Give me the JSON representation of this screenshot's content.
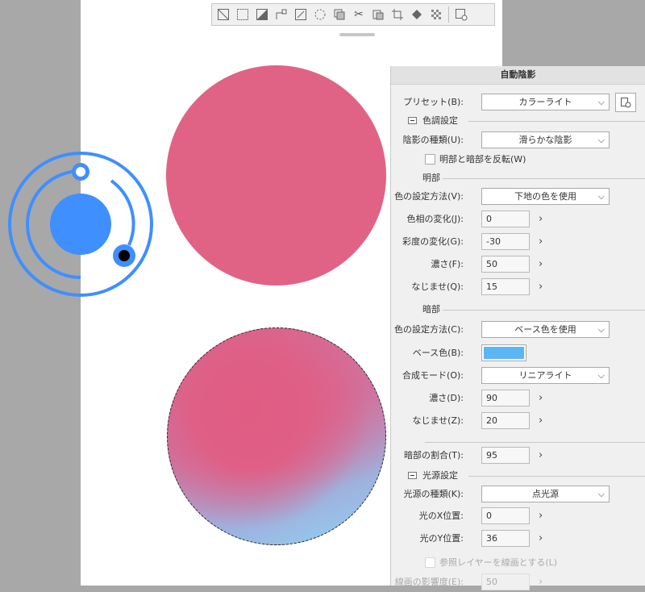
{
  "toolbar": {
    "icons": [
      "no-snap-icon",
      "selection-frame-icon",
      "fill-half-icon",
      "corner-icon",
      "transform-icon",
      "sparkle-icon",
      "copy-layer-icon",
      "cut-icon",
      "paste-icon",
      "crop-icon",
      "fill-icon",
      "dither-icon",
      "settings-icon"
    ]
  },
  "panel": {
    "title": "自動陰影",
    "preset": {
      "label": "プリセット(B):",
      "value": "カラーライト"
    },
    "tone_section": {
      "title": "色調設定",
      "shadow_type": {
        "label": "陰影の種類(U):",
        "value": "滑らかな陰影"
      },
      "invert": {
        "label": "明部と暗部を反転(W)"
      }
    },
    "light": {
      "title": "明部",
      "color_method": {
        "label": "色の設定方法(V):",
        "value": "下地の色を使用"
      },
      "hue": {
        "label": "色相の変化(J):",
        "value": "0"
      },
      "saturation": {
        "label": "彩度の変化(G):",
        "value": "-30"
      },
      "density": {
        "label": "濃さ(F):",
        "value": "50"
      },
      "blend": {
        "label": "なじませ(Q):",
        "value": "15"
      }
    },
    "dark": {
      "title": "暗部",
      "color_method": {
        "label": "色の設定方法(C):",
        "value": "ベース色を使用"
      },
      "base_color": {
        "label": "ベース色(B):",
        "color": "#5bb6f5"
      },
      "blend_mode": {
        "label": "合成モード(O):",
        "value": "リニアライト"
      },
      "density": {
        "label": "濃さ(D):",
        "value": "90"
      },
      "blend": {
        "label": "なじませ(Z):",
        "value": "20"
      }
    },
    "dark_ratio": {
      "label": "暗部の割合(T):",
      "value": "95"
    },
    "light_source": {
      "title": "光源設定",
      "type": {
        "label": "光源の種類(K):",
        "value": "点光源"
      },
      "x": {
        "label": "光のX位置:",
        "value": "0"
      },
      "y": {
        "label": "光のY位置:",
        "value": "36"
      }
    },
    "ref_layer": {
      "label": "参照レイヤーを線画とする(L)"
    },
    "line_density": {
      "label": "線画の影響度(E):",
      "value": "50"
    }
  },
  "colors": {
    "circle_fill": "#e06385",
    "light_widget": "#3f8ffe",
    "base_color": "#5bb6f5"
  }
}
